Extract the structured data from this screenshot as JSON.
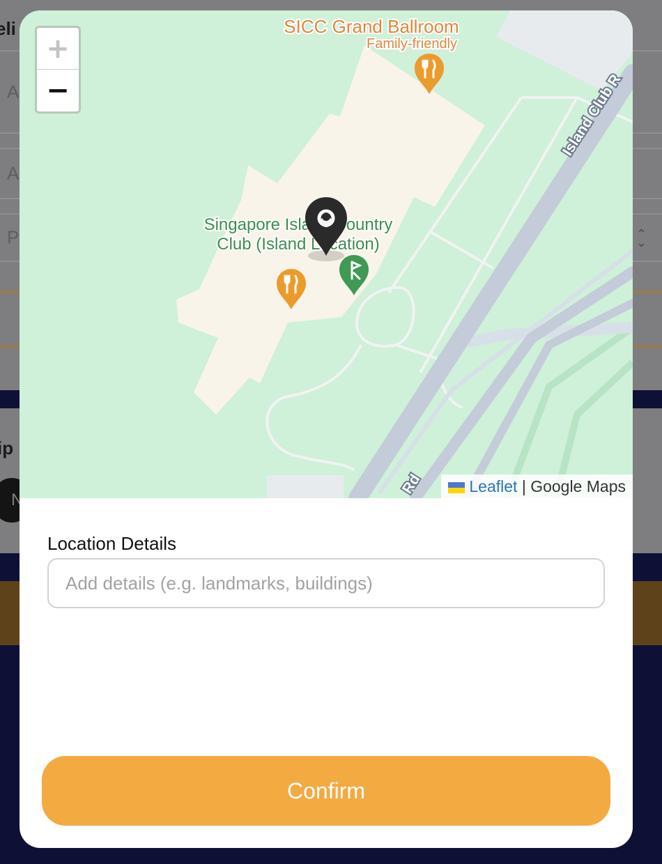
{
  "background": {
    "partial_heading_top": "eli",
    "partial_heading_mid": "ip",
    "field_1_partial": "A",
    "field_2_partial": "A",
    "field_3_partial": "P",
    "pill_partial": "N"
  },
  "map": {
    "labels": {
      "ballroom_name": "SICC Grand Ballroom",
      "ballroom_tag": "Family-friendly",
      "club_line1": "Singapore Island Country",
      "club_line2": "Club (Island Location)",
      "road_upper": "Island Club R",
      "road_lower": "Rd"
    },
    "zoom_in": "+",
    "zoom_out": "−",
    "attribution": {
      "leaflet": "Leaflet",
      "separator": "|",
      "provider": "Google Maps"
    },
    "colors": {
      "park": "#cff0d9",
      "building": "#f8f4ea",
      "road": "#c3ccd8",
      "food_pin": "#eb9b2c",
      "golf_pin": "#3f9a53",
      "location_marker": "#2a2a2a"
    },
    "icons": [
      "restaurant-pin-icon",
      "golf-pin-icon",
      "location-marker-icon"
    ]
  },
  "form": {
    "location_label": "Location Details",
    "details_placeholder": "Add details (e.g. landmarks, buildings)",
    "details_value": ""
  },
  "confirm_label": "Confirm"
}
